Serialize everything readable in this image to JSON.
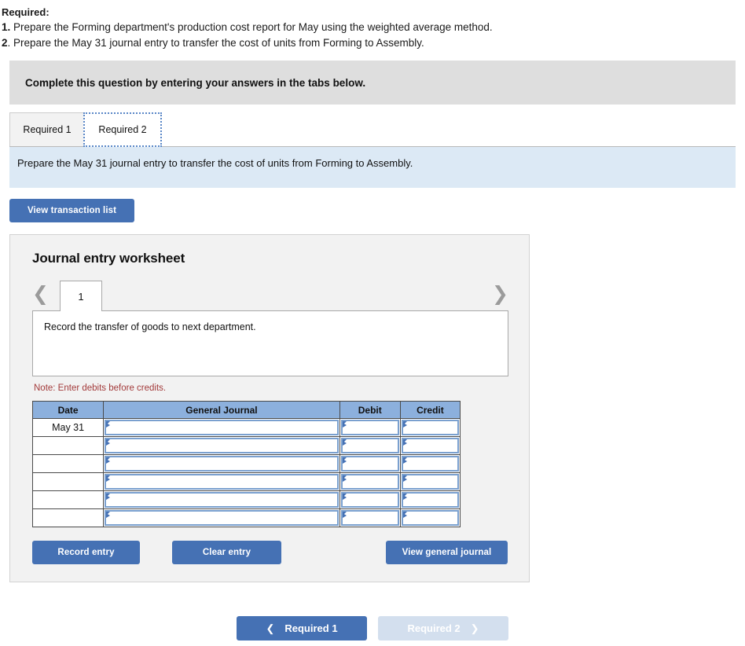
{
  "required": {
    "heading": "Required:",
    "items": [
      {
        "num": "1.",
        "text": " Prepare the Forming department's production cost report for May using the weighted average method."
      },
      {
        "num": "2",
        "text": ". Prepare the May 31 journal entry to transfer the cost of units from Forming to Assembly."
      }
    ]
  },
  "banner": {
    "text": "Complete this question by entering your answers in the tabs below."
  },
  "tabs": [
    {
      "label": "Required 1",
      "active": false
    },
    {
      "label": "Required 2",
      "active": true
    }
  ],
  "prompt": {
    "text": "Prepare the May 31 journal entry to transfer the cost of units from Forming to Assembly."
  },
  "toolbar": {
    "view_transaction_list_label": "View transaction list"
  },
  "worksheet": {
    "title": "Journal entry worksheet",
    "pager": {
      "prev_icon": "chevron-left",
      "next_icon": "chevron-right",
      "current_page": "1"
    },
    "description": "Record the transfer of goods to next department.",
    "note": "Note: Enter debits before credits.",
    "table": {
      "headers": [
        "Date",
        "General Journal",
        "Debit",
        "Credit"
      ],
      "rows": [
        {
          "date": "May 31",
          "general_journal": "",
          "debit": "",
          "credit": ""
        },
        {
          "date": "",
          "general_journal": "",
          "debit": "",
          "credit": ""
        },
        {
          "date": "",
          "general_journal": "",
          "debit": "",
          "credit": ""
        },
        {
          "date": "",
          "general_journal": "",
          "debit": "",
          "credit": ""
        },
        {
          "date": "",
          "general_journal": "",
          "debit": "",
          "credit": ""
        },
        {
          "date": "",
          "general_journal": "",
          "debit": "",
          "credit": ""
        }
      ]
    },
    "actions": {
      "record_entry_label": "Record entry",
      "clear_entry_label": "Clear entry",
      "view_general_journal_label": "View general journal"
    }
  },
  "bottom_nav": {
    "prev_label": "Required 1",
    "prev_icon": "chevron-left",
    "next_label": "Required 2",
    "next_icon": "chevron-right",
    "next_disabled": true
  },
  "colors": {
    "accent_blue": "#4571b4",
    "table_header_blue": "#8cb0dd",
    "prompt_blue": "#dce9f5",
    "banner_grey": "#dedede",
    "panel_grey": "#f2f2f2",
    "note_red": "#a33b3b",
    "nav_disabled": "#d3dfee"
  }
}
